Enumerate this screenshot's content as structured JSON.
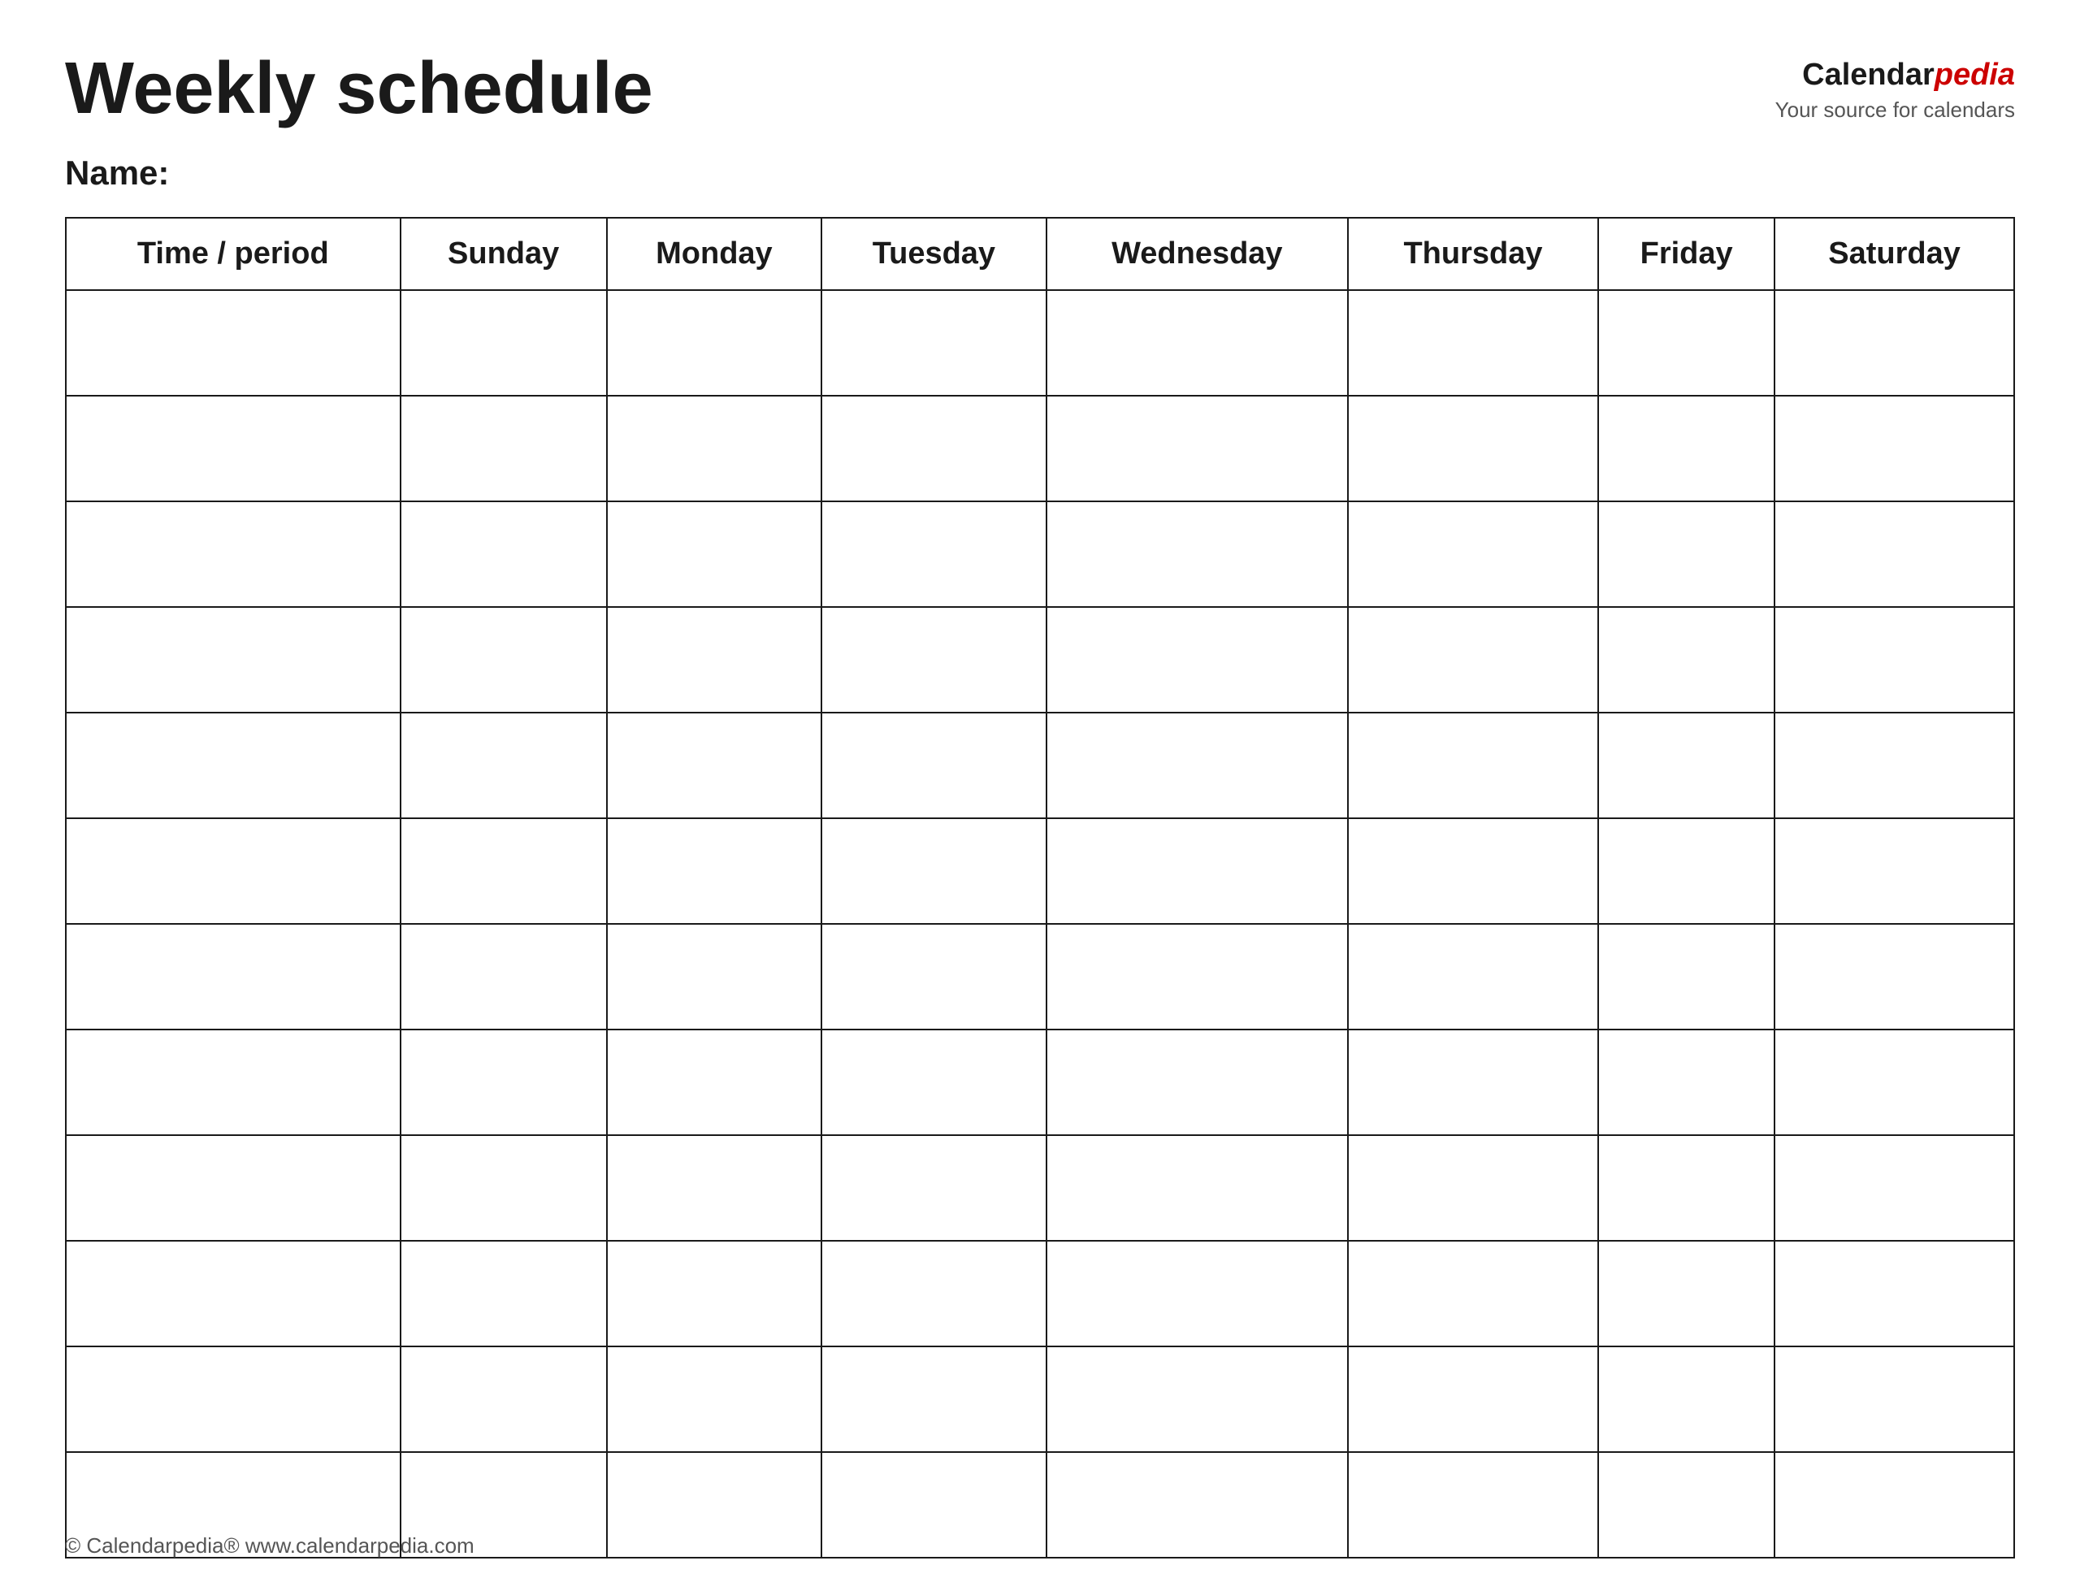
{
  "header": {
    "title": "Weekly schedule",
    "logo": {
      "calendar_part": "Calendar",
      "pedia_part": "pedia",
      "subtitle": "Your source for calendars"
    }
  },
  "name_label": "Name:",
  "table": {
    "columns": [
      "Time / period",
      "Sunday",
      "Monday",
      "Tuesday",
      "Wednesday",
      "Thursday",
      "Friday",
      "Saturday"
    ],
    "row_count": 12
  },
  "footer": {
    "text": "© Calendarpedia®  www.calendarpedia.com"
  }
}
